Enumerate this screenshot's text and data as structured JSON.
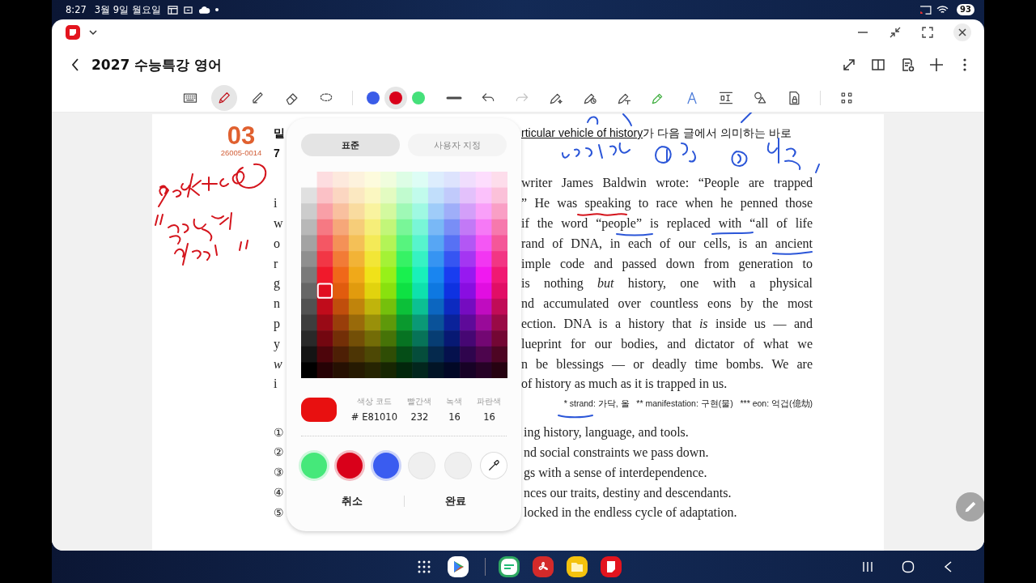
{
  "status_bar": {
    "time": "8:27",
    "date": "3월 9일 월요일",
    "battery": "93"
  },
  "window": {
    "title": "2027 수능특강 영어"
  },
  "toolbar": [
    {
      "kind": "keyboard",
      "selected": false,
      "disabled": false
    },
    {
      "kind": "pen",
      "selected": true,
      "disabled": false
    },
    {
      "kind": "highlighter",
      "selected": false,
      "disabled": false
    },
    {
      "kind": "eraser",
      "selected": false,
      "disabled": false
    },
    {
      "kind": "lasso",
      "selected": false,
      "disabled": false
    },
    {
      "kind": "separator"
    },
    {
      "kind": "color",
      "color": "#3a5ce8",
      "selected": false
    },
    {
      "kind": "color",
      "color": "#d9001a",
      "selected": true
    },
    {
      "kind": "color",
      "color": "#45e07a",
      "selected": false
    },
    {
      "kind": "thickness",
      "selected": false,
      "disabled": false
    },
    {
      "kind": "undo",
      "selected": false,
      "disabled": false
    },
    {
      "kind": "redo",
      "selected": false,
      "disabled": true
    },
    {
      "kind": "magic-pen",
      "selected": false,
      "disabled": false
    },
    {
      "kind": "pen-timer",
      "selected": false,
      "disabled": false
    },
    {
      "kind": "pen-text",
      "selected": false,
      "disabled": false
    },
    {
      "kind": "marker",
      "selected": false,
      "disabled": false
    },
    {
      "kind": "text-style",
      "selected": false,
      "disabled": false
    },
    {
      "kind": "text-fit",
      "selected": false,
      "disabled": false
    },
    {
      "kind": "shapes",
      "selected": false,
      "disabled": false
    },
    {
      "kind": "page-lock",
      "selected": false,
      "disabled": false
    },
    {
      "kind": "separator"
    },
    {
      "kind": "more-tools",
      "selected": false,
      "disabled": false
    }
  ],
  "document": {
    "number": "03",
    "code": "26005-0014",
    "question": {
      "left": "밑",
      "underlined": "rticular vehicle of history",
      "rest": "가 다음 글에서 의미하는 바로",
      "second_line": "7"
    },
    "passage": [
      {
        "right": "writer James Baldwin wrote: “People are trapped"
      },
      {
        "left": "i",
        "left_italic": false,
        "right": "” He was speaking to race when he penned those"
      },
      {
        "left": "w",
        "left_italic": false,
        "right": "if the word “people” is replaced with “all of life"
      },
      {
        "left": "o",
        "left_italic": false,
        "right": "rand of DNA, in each of our cells, is an ancient"
      },
      {
        "left": "r",
        "left_italic": false,
        "right": "imple code and passed down from generation to"
      },
      {
        "left": "g",
        "left_italic": false,
        "right": "is nothing *but* history, one with a physical"
      },
      {
        "left": "n",
        "left_italic": false,
        "right": "nd accumulated over countless eons by the most"
      },
      {
        "left": "p",
        "left_italic": false,
        "right": "ection. DNA is a history that *is* inside us — and"
      },
      {
        "left": "y",
        "left_italic": false,
        "right": "lueprint for our bodies, and dictator of what we"
      },
      {
        "left": "w",
        "left_italic": true,
        "right": "n be blessings — or deadly time bombs. We are"
      },
      {
        "left": "i",
        "left_italic": false,
        "right": "of history as much as it is trapped in us."
      }
    ],
    "footnote": "* strand: 가닥, 올   ** manifestation: 구현(물)   *** eon: 억겁(億劫)",
    "options": [
      {
        "number": "①",
        "text": "ing history, language, and tools."
      },
      {
        "number": "②",
        "text": "nd social constraints we pass down."
      },
      {
        "number": "③",
        "text": "gs with a sense of interdependence."
      },
      {
        "number": "④",
        "text": "nces our traits, destiny and descendants."
      },
      {
        "number": "⑤",
        "text": "locked in the endless cycle of adaptation."
      }
    ]
  },
  "color_picker": {
    "tabs": [
      {
        "label": "표준",
        "selected": true
      },
      {
        "label": "사용자 지정",
        "selected": false
      }
    ],
    "fields": [
      {
        "label": "색상 코드",
        "value": "# E81010"
      },
      {
        "label": "빨간색",
        "value": "232"
      },
      {
        "label": "녹색",
        "value": "16"
      },
      {
        "label": "파란색",
        "value": "16"
      }
    ],
    "recent": [
      {
        "kind": "color",
        "color": "#45e87a"
      },
      {
        "kind": "color",
        "color": "#d9001a"
      },
      {
        "kind": "color",
        "color": "#3a5cf0"
      },
      {
        "kind": "empty"
      },
      {
        "kind": "empty"
      },
      {
        "kind": "eyedropper"
      }
    ],
    "buttons": [
      "취소",
      "완료"
    ]
  }
}
